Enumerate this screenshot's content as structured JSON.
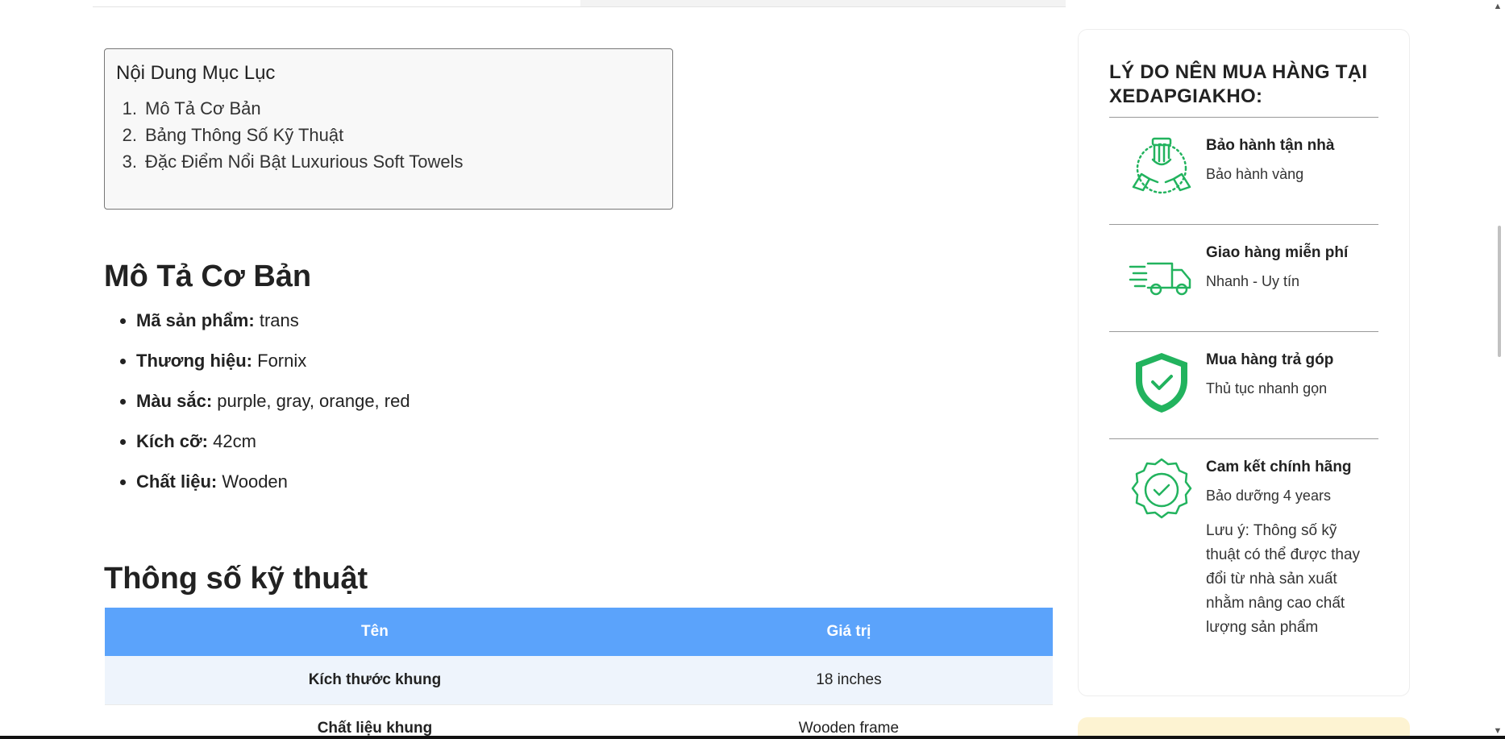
{
  "toc": {
    "title": "Nội Dung Mục Lục",
    "items": [
      {
        "num": "1.",
        "label": "Mô Tả Cơ Bản"
      },
      {
        "num": "2.",
        "label": "Bảng Thông Số Kỹ Thuật"
      },
      {
        "num": "3.",
        "label": "Đặc Điểm Nổi Bật Luxurious Soft Towels"
      }
    ]
  },
  "basic": {
    "heading": "Mô Tả Cơ Bản",
    "items": [
      {
        "label": "Mã sản phẩm:",
        "value": "trans"
      },
      {
        "label": "Thương hiệu:",
        "value": "Fornix"
      },
      {
        "label": "Màu sắc:",
        "value": "purple, gray, orange, red"
      },
      {
        "label": "Kích cỡ:",
        "value": "42cm"
      },
      {
        "label": "Chất liệu:",
        "value": "Wooden"
      }
    ]
  },
  "spec": {
    "heading": "Thông số kỹ thuật",
    "columns": [
      "Tên",
      "Giá trị"
    ],
    "rows": [
      {
        "name": "Kích thước khung",
        "value": "18 inches"
      },
      {
        "name": "Chất liệu khung",
        "value": "Wooden frame"
      }
    ]
  },
  "sidebar": {
    "title": "LÝ DO NÊN MUA HÀNG TẠI XEDAPGIAKHO:",
    "features": [
      {
        "icon": "hands-icon",
        "title": "Bảo hành tận nhà",
        "subtitle": "Bảo hành vàng"
      },
      {
        "icon": "delivery-truck-icon",
        "title": "Giao hàng miễn phí",
        "subtitle": "Nhanh - Uy tín"
      },
      {
        "icon": "shield-check-icon",
        "title": "Mua hàng trả góp",
        "subtitle": "Thủ tục nhanh gọn"
      },
      {
        "icon": "badge-check-icon",
        "title": "Cam kết chính hãng",
        "subtitle": "Bảo dưỡng 4 years",
        "note": "Lưu ý: Thông số kỹ thuật có thể được thay đổi từ nhà sản xuất nhằm nâng cao chất lượng sản phẩm"
      }
    ]
  },
  "colors": {
    "accent_green": "#22b35e",
    "table_header": "#5ba3fb",
    "table_alt_row": "#eef4fc",
    "promo_bg": "#fdf3d2"
  }
}
